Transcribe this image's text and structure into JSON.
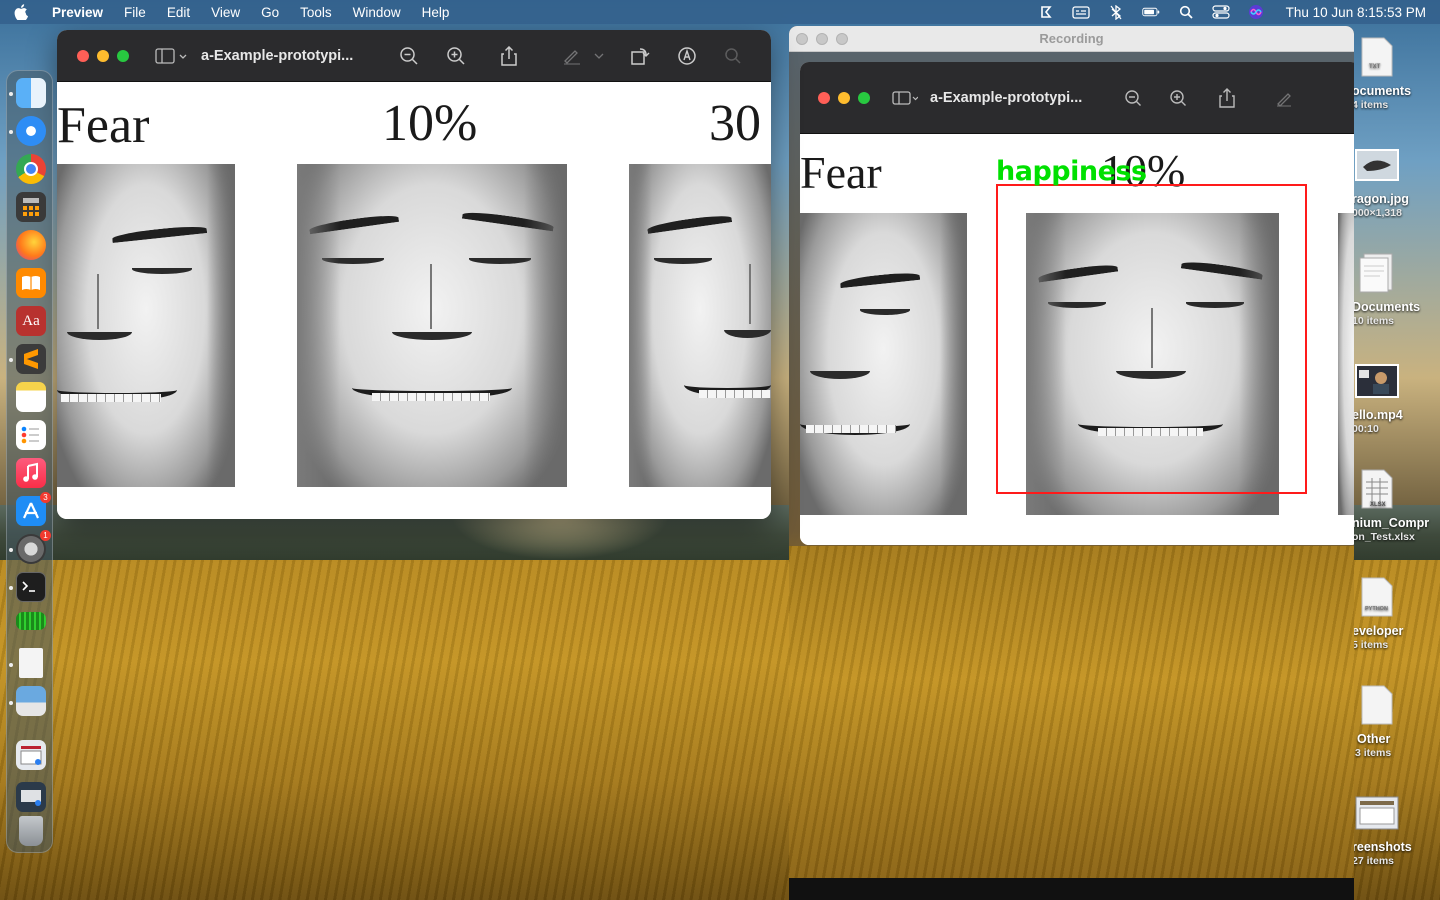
{
  "menubar": {
    "app_name": "Preview",
    "items": [
      "File",
      "Edit",
      "View",
      "Go",
      "Tools",
      "Window",
      "Help"
    ],
    "clock": "Thu 10 Jun  8:15:53 PM"
  },
  "dock": {
    "apps": [
      {
        "name": "finder",
        "color": "#3b8ff0"
      },
      {
        "name": "safari",
        "color": "#2e8df5"
      },
      {
        "name": "chrome",
        "color": "#e8e8e8"
      },
      {
        "name": "calculator",
        "color": "#3a3a3a"
      },
      {
        "name": "firefox",
        "color": "#ff7a1a"
      },
      {
        "name": "books",
        "color": "#ff8a00"
      },
      {
        "name": "dictionary",
        "color": "#b8322f"
      },
      {
        "name": "sublime-text",
        "color": "#4a4a4a"
      },
      {
        "name": "notes",
        "color": "#f6d34b"
      },
      {
        "name": "reminders",
        "color": "#f2f2f2"
      },
      {
        "name": "music",
        "color": "#fa3a55"
      },
      {
        "name": "app-store",
        "color": "#1f8df5"
      },
      {
        "name": "system-preferences",
        "color": "#8a8a8a"
      },
      {
        "name": "terminal",
        "color": "#1e1e1e"
      },
      {
        "name": "memory-monitor",
        "color": "#2aa02a"
      },
      {
        "name": "document",
        "color": "#f4f4f4"
      },
      {
        "name": "preview",
        "color": "#6aa9e0"
      },
      {
        "name": "screenshots-folder",
        "color": "#dfe3e8"
      },
      {
        "name": "downloads-folder",
        "color": "#2b3a4a"
      },
      {
        "name": "trash",
        "color": "#9ea3a8"
      }
    ],
    "badges": {
      "app_store": "3",
      "system_preferences": "1"
    }
  },
  "preview_window": {
    "title": "a-Example-prototypi...",
    "label_left": "Fear",
    "label_center": "10%",
    "label_right": "30"
  },
  "recording_window": {
    "title": "Recording",
    "inner_title": "a-Example-prototypi...",
    "label_left": "Fear",
    "label_center": "10%",
    "detection_label": "happiness",
    "detection_color": "#00e000",
    "box_color": "#ff1a1a"
  },
  "desktop_items": [
    {
      "label": "ocuments",
      "sub": "4 items",
      "icon": "text-file-icon"
    },
    {
      "label": "ragon.jpg",
      "sub": "000×1,318",
      "icon": "image-thumbnail-icon"
    },
    {
      "label": "Documents",
      "sub": "10 items",
      "icon": "folder-docs-icon"
    },
    {
      "label": "ello.mp4",
      "sub": "00:10",
      "icon": "video-thumbnail-icon"
    },
    {
      "label": "nium_Compr",
      "sub": "on_Test.xlsx",
      "icon": "spreadsheet-icon"
    },
    {
      "label": "eveloper",
      "sub": "5 items",
      "icon": "python-file-icon"
    },
    {
      "label": "Other",
      "sub": "3 items",
      "icon": "blank-file-icon"
    },
    {
      "label": "reenshots",
      "sub": "27 items",
      "icon": "screenshot-folder-icon"
    }
  ]
}
